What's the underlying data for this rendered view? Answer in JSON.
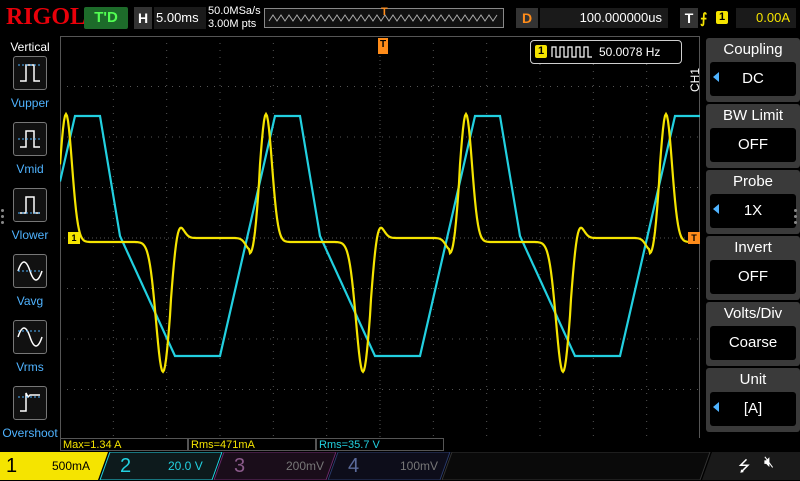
{
  "topbar": {
    "brand": "RIGOL",
    "trigger_status": "T'D",
    "horizontal": {
      "letter": "H",
      "value": "5.00ms"
    },
    "sample_rate": "50.0MSa/s",
    "memory_depth": "3.00M pts",
    "memory_marker": "T",
    "delay": {
      "letter": "D",
      "value": "100.000000us"
    },
    "trigger": {
      "letter": "T",
      "edge": "⨍",
      "source": "1",
      "level": "0.00A"
    }
  },
  "left_panel": {
    "title": "Vertical",
    "items": [
      {
        "label": "Vupper",
        "icon": "vupper-icon"
      },
      {
        "label": "Vmid",
        "icon": "vmid-icon"
      },
      {
        "label": "Vlower",
        "icon": "vlower-icon"
      },
      {
        "label": "Vavg",
        "icon": "vavg-icon"
      },
      {
        "label": "Vrms",
        "icon": "vrms-icon"
      },
      {
        "label": "Overshoot",
        "icon": "overshoot-icon"
      }
    ]
  },
  "screen": {
    "freq_counter": {
      "channel": "1",
      "value": "50.0078 Hz"
    },
    "trigger_position_marker": "T",
    "ch1_marker": "1",
    "trigger_level_marker": "T",
    "colors": {
      "ch1": "#f5e400",
      "ch2": "#22d0e0",
      "grid": "#555555",
      "trigger": "#ff8c1a"
    }
  },
  "right_menu": {
    "channel": "CH1",
    "items": [
      {
        "title": "Coupling",
        "value": "DC",
        "arrow": true
      },
      {
        "title": "BW Limit",
        "value": "OFF",
        "arrow": false
      },
      {
        "title": "Probe",
        "value": "1X",
        "arrow": true
      },
      {
        "title": "Invert",
        "value": "OFF",
        "arrow": false
      },
      {
        "title": "Volts/Div",
        "value": "Coarse",
        "arrow": false
      },
      {
        "title": "Unit",
        "value": "[A]",
        "arrow": true
      }
    ]
  },
  "measurements": [
    {
      "text": "Max=1.34 A",
      "color": "#f5e400"
    },
    {
      "text": "Rms=471mA",
      "color": "#f5e400"
    },
    {
      "text": "Rms=35.7 V",
      "color": "#22d0e0"
    }
  ],
  "channels": [
    {
      "num": "1",
      "scale": "500mA",
      "color": "#f5e400",
      "active": true
    },
    {
      "num": "2",
      "scale": "20.0 V",
      "color": "#22d0e0",
      "active": true
    },
    {
      "num": "3",
      "scale": "200mV",
      "color": "#d040d0",
      "active": false
    },
    {
      "num": "4",
      "scale": "100mV",
      "color": "#3f6fff",
      "active": false
    }
  ]
}
